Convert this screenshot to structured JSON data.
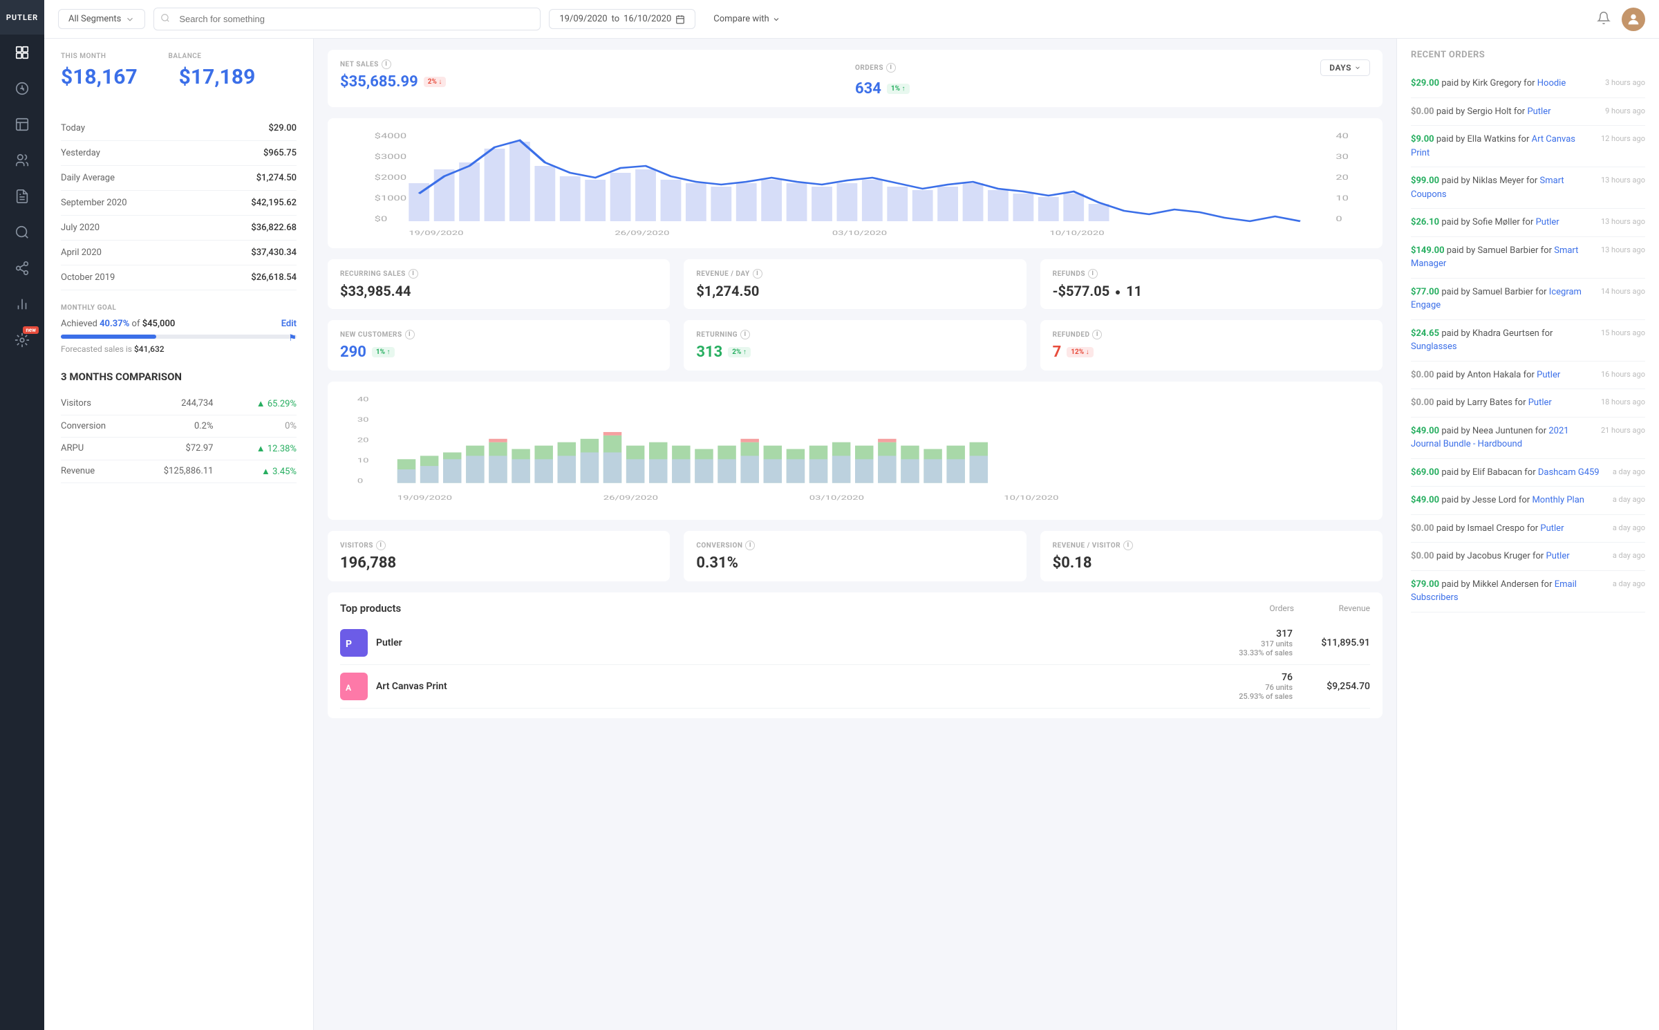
{
  "sidebar": {
    "logo": "PUTLER",
    "icons": [
      {
        "name": "dashboard-icon",
        "symbol": "⊞"
      },
      {
        "name": "sales-icon",
        "symbol": "💲"
      },
      {
        "name": "orders-icon",
        "symbol": "📦"
      },
      {
        "name": "customers-icon",
        "symbol": "👥"
      },
      {
        "name": "reports-icon",
        "symbol": "📊"
      },
      {
        "name": "analytics-icon",
        "symbol": "🔍"
      },
      {
        "name": "affiliates-icon",
        "symbol": "👤"
      },
      {
        "name": "charts-icon",
        "symbol": "📈"
      },
      {
        "name": "integrations-icon",
        "symbol": "🔌",
        "badge": "new"
      }
    ]
  },
  "topbar": {
    "segment": "All Segments",
    "search_placeholder": "Search for something",
    "date_from": "19/09/2020",
    "date_to": "16/10/2020",
    "compare_label": "Compare with"
  },
  "stats": {
    "this_month_label": "THIS MONTH",
    "balance_label": "BALANCE",
    "this_month_val": "$18,167",
    "balance_val": "$17,189",
    "rows": [
      {
        "label": "Today",
        "value": "$29.00"
      },
      {
        "label": "Yesterday",
        "value": "$965.75"
      },
      {
        "label": "Daily Average",
        "value": "$1,274.50"
      },
      {
        "label": "September 2020",
        "value": "$42,195.62"
      },
      {
        "label": "July 2020",
        "value": "$36,822.68"
      },
      {
        "label": "April 2020",
        "value": "$37,430.34"
      },
      {
        "label": "October 2019",
        "value": "$26,618.54"
      }
    ]
  },
  "goal": {
    "title": "MONTHLY GOAL",
    "achieved_pct": "40.37%",
    "of_amount": "$45,000",
    "edit_label": "Edit",
    "forecast_prefix": "Forecasted sales is",
    "forecast_val": "$41,632",
    "progress_width": "40.37"
  },
  "three_months": {
    "title": "3 MONTHS COMPARISON",
    "rows": [
      {
        "label": "Visitors",
        "value": "244,734",
        "change": "65.29%",
        "up": true
      },
      {
        "label": "Conversion",
        "value": "0.2%",
        "change": "0%",
        "up": false,
        "neutral": true
      },
      {
        "label": "ARPU",
        "value": "$72.97",
        "change": "12.38%",
        "up": true
      },
      {
        "label": "Revenue",
        "value": "$125,886.11",
        "change": "3.45%",
        "up": true
      }
    ]
  },
  "net_sales": {
    "label": "NET SALES",
    "value": "$35,685.99",
    "badge_pct": "2%",
    "badge_dir": "down"
  },
  "orders": {
    "label": "ORDERS",
    "value": "634",
    "badge_pct": "1%",
    "badge_dir": "up",
    "days_label": "Days"
  },
  "recurring": {
    "label": "RECURRING SALES",
    "value": "$33,985.44"
  },
  "revenue_day": {
    "label": "REVENUE / DAY",
    "value": "$1,274.50"
  },
  "refunds": {
    "label": "REFUNDS",
    "value": "-$577.05",
    "count": "11"
  },
  "new_customers": {
    "label": "NEW CUSTOMERS",
    "value": "290",
    "badge_pct": "1%",
    "badge_dir": "up"
  },
  "returning": {
    "label": "RETURNING",
    "value": "313",
    "badge_pct": "2%",
    "badge_dir": "up"
  },
  "refunded": {
    "label": "REFUNDED",
    "value": "7",
    "badge_pct": "12%",
    "badge_dir": "down"
  },
  "visitors": {
    "label": "VISITORS",
    "value": "196,788"
  },
  "conversion": {
    "label": "CONVERSION",
    "value": "0.31%"
  },
  "revenue_visitor": {
    "label": "REVENUE / VISITOR",
    "value": "$0.18"
  },
  "top_products": {
    "title": "Top products",
    "orders_col": "Orders",
    "revenue_col": "Revenue",
    "items": [
      {
        "name": "Putler",
        "orders": "317",
        "units": "317 units",
        "pct_sales": "33.33% of sales",
        "revenue": "$11,895.91",
        "color": "#6c5ce7"
      },
      {
        "name": "Art Canvas Print",
        "orders": "76",
        "units": "76 units",
        "pct_sales": "25.93% of sales",
        "revenue": "$9,254.70",
        "color": "#fd79a8"
      }
    ]
  },
  "recent_orders": {
    "title": "RECENT ORDERS",
    "items": [
      {
        "amount": "$29.00",
        "paid_by": "Kirk Gregory",
        "for_product": "Hoodie",
        "time": "3 hours ago",
        "green": true
      },
      {
        "amount": "$0.00",
        "paid_by": "Sergio Holt",
        "for_product": "Putler",
        "time": "9 hours ago",
        "green": false
      },
      {
        "amount": "$9.00",
        "paid_by": "Ella Watkins",
        "for_product": "Art Canvas Print",
        "time": "12 hours ago",
        "green": true
      },
      {
        "amount": "$99.00",
        "paid_by": "Niklas Meyer",
        "for_product": "Smart Coupons",
        "time": "13 hours ago",
        "green": true
      },
      {
        "amount": "$26.10",
        "paid_by": "Sofie Møller",
        "for_product": "Putler",
        "time": "13 hours ago",
        "green": true
      },
      {
        "amount": "$149.00",
        "paid_by": "Samuel Barbier",
        "for_product": "Smart Manager",
        "time": "13 hours ago",
        "green": true
      },
      {
        "amount": "$77.00",
        "paid_by": "Samuel Barbier",
        "for_product": "Icegram Engage",
        "time": "14 hours ago",
        "green": true
      },
      {
        "amount": "$24.65",
        "paid_by": "Khadra Geurtsen",
        "for_product": "Sunglasses",
        "time": "15 hours ago",
        "green": true
      },
      {
        "amount": "$0.00",
        "paid_by": "Anton Hakala",
        "for_product": "Putler",
        "time": "16 hours ago",
        "green": false
      },
      {
        "amount": "$0.00",
        "paid_by": "Larry Bates",
        "for_product": "Putler",
        "time": "18 hours ago",
        "green": false
      },
      {
        "amount": "$49.00",
        "paid_by": "Neea Juntunen",
        "for_product": "2021 Journal Bundle - Hardbound",
        "time": "21 hours ago",
        "green": true
      },
      {
        "amount": "$69.00",
        "paid_by": "Elif Babacan",
        "for_product": "Dashcam G459",
        "time": "a day ago",
        "green": true
      },
      {
        "amount": "$49.00",
        "paid_by": "Jesse Lord",
        "for_product": "Monthly Plan",
        "time": "a day ago",
        "green": true
      },
      {
        "amount": "$0.00",
        "paid_by": "Ismael Crespo",
        "for_product": "Putler",
        "time": "a day ago",
        "green": false
      },
      {
        "amount": "$0.00",
        "paid_by": "Jacobus Kruger",
        "for_product": "Putler",
        "time": "a day ago",
        "green": false
      },
      {
        "amount": "$79.00",
        "paid_by": "Mikkel Andersen",
        "for_product": "Email Subscribers",
        "time": "a day ago",
        "green": true
      }
    ]
  },
  "chart_dates": [
    "19/09/2020",
    "26/09/2020",
    "03/10/2020",
    "10/10/2020"
  ],
  "chart2_dates": [
    "19/09/2020",
    "26/09/2020",
    "03/10/2020",
    "10/10/2020"
  ]
}
